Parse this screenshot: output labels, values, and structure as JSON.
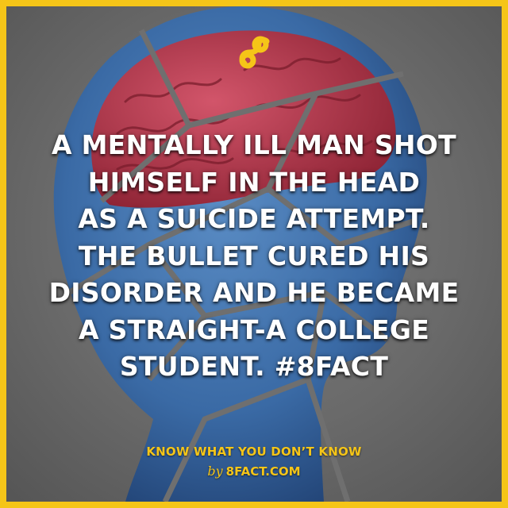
{
  "fact": {
    "lines": [
      "A MENTALLY ILL MAN SHOT",
      "HIMSELF IN THE HEAD",
      "AS A SUICIDE ATTEMPT.",
      "THE BULLET CURED HIS",
      "DISORDER AND HE BECAME",
      "A STRAIGHT-A COLLEGE",
      "STUDENT. #8FACT"
    ]
  },
  "footer": {
    "tagline": "KNOW WHAT YOU DON’T KNOW",
    "by": "by",
    "site": "8FACT.COM"
  },
  "colors": {
    "frame": "#f5c518",
    "background": "#6d6d6d",
    "head_blue": "#3f6ea8",
    "brain_red": "#b23a4a",
    "text": "#ffffff",
    "accent": "#f5c518"
  },
  "icons": {
    "logo": "infinity-eight-logo-icon"
  }
}
